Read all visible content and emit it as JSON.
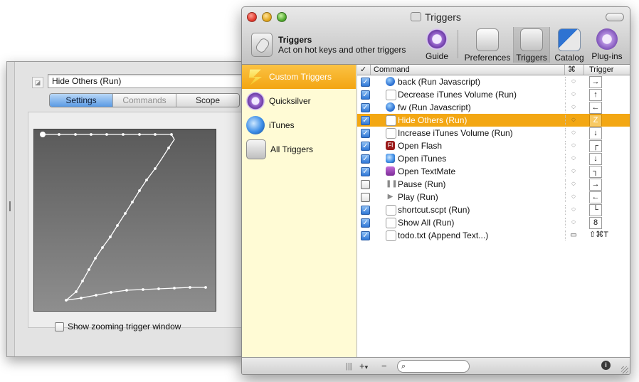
{
  "drawer": {
    "trigger_name": "Hide Others (Run)",
    "tabs": [
      "Settings",
      "Commands",
      "Scope"
    ],
    "active_tab": "Settings",
    "zoom_checkbox_label": "Show zooming trigger window",
    "zoom_checkbox_checked": false
  },
  "window": {
    "title": "Triggers",
    "header_title": "Triggers",
    "header_subtitle": "Act on hot keys and other triggers",
    "toolbar": {
      "guide": "Guide",
      "preferences": "Preferences",
      "triggers": "Triggers",
      "catalog": "Catalog",
      "plugins": "Plug-ins"
    }
  },
  "sidebar": {
    "items": [
      {
        "label": "Custom Triggers",
        "selected": true
      },
      {
        "label": "Quicksilver",
        "selected": false
      },
      {
        "label": "iTunes",
        "selected": false
      },
      {
        "label": "All Triggers",
        "selected": false
      }
    ]
  },
  "table": {
    "headers": {
      "check": "✓",
      "command": "Command",
      "key": "⌘",
      "trigger": "Trigger"
    },
    "rows": [
      {
        "checked": true,
        "icon": "globe-icon",
        "command": "back (Run Javascript)",
        "trigger": "→",
        "selected": false
      },
      {
        "checked": true,
        "icon": "document-icon",
        "command": "Decrease iTunes Volume (Run)",
        "trigger": "↑",
        "selected": false
      },
      {
        "checked": true,
        "icon": "globe-icon",
        "command": "fw (Run Javascript)",
        "trigger": "←",
        "selected": false
      },
      {
        "checked": true,
        "icon": "app-icon",
        "command": "Hide Others (Run)",
        "trigger": "Z",
        "selected": true
      },
      {
        "checked": true,
        "icon": "document-icon",
        "command": "Increase iTunes Volume (Run)",
        "trigger": "↓",
        "selected": false
      },
      {
        "checked": true,
        "icon": "flash-icon",
        "command": "Open Flash",
        "trigger": "┌",
        "selected": false
      },
      {
        "checked": true,
        "icon": "itunes-icon",
        "command": "Open iTunes",
        "trigger": "↓",
        "selected": false
      },
      {
        "checked": true,
        "icon": "textmate-icon",
        "command": "Open TextMate",
        "trigger": "┐",
        "selected": false
      },
      {
        "checked": false,
        "icon": "pause-icon",
        "command": "Pause (Run)",
        "trigger": "→",
        "selected": false
      },
      {
        "checked": false,
        "icon": "play-icon",
        "command": "Play (Run)",
        "trigger": "←",
        "selected": false
      },
      {
        "checked": true,
        "icon": "script-icon",
        "command": "shortcut.scpt (Run)",
        "trigger": "└",
        "selected": false
      },
      {
        "checked": true,
        "icon": "show-all-icon",
        "command": "Show All (Run)",
        "trigger": "8",
        "selected": false
      },
      {
        "checked": true,
        "icon": "text-file-icon",
        "command": "todo.txt (Append Text...)",
        "trigger": "⇧⌘T",
        "selected": false
      }
    ]
  },
  "bottombar": {
    "add": "+",
    "add_menu": "▾",
    "remove": "−",
    "search_placeholder": "",
    "info": "i"
  }
}
